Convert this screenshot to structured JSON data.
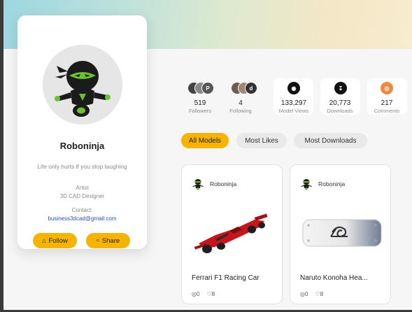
{
  "profile": {
    "name": "Roboninja",
    "bio": "Life only hurts if you stop laughing",
    "role_line1": "Artist",
    "role_line2": "3D CAD Designer",
    "contact_label": "Contact:",
    "contact_email": "business3dcad@gmail.com",
    "follow_label": "Follow",
    "share_label": "Share"
  },
  "stats": [
    {
      "value": "519",
      "label": "Followers"
    },
    {
      "value": "4",
      "label": "Following"
    },
    {
      "value": "133,297",
      "label": "Model Views"
    },
    {
      "value": "20,773",
      "label": "Downloads"
    },
    {
      "value": "217",
      "label": "Comments"
    }
  ],
  "filters": {
    "all": "All Models",
    "likes": "Most Likes",
    "downloads": "Most Downloads"
  },
  "models": [
    {
      "author": "Roboninja",
      "title": "Ferrari F1 Racing Car",
      "comments": "0",
      "likes": "8"
    },
    {
      "author": "Roboninja",
      "title": "Naruto Konoha Hea...",
      "comments": "0",
      "likes": "8"
    }
  ],
  "colors": {
    "accent": "#f6b400",
    "link": "#2f4fb5",
    "comment_orange": "#ee8b40"
  },
  "icons": {
    "follow": "person-plus-icon",
    "share": "share-icon",
    "comment": "comment-icon",
    "like": "heart-icon"
  }
}
